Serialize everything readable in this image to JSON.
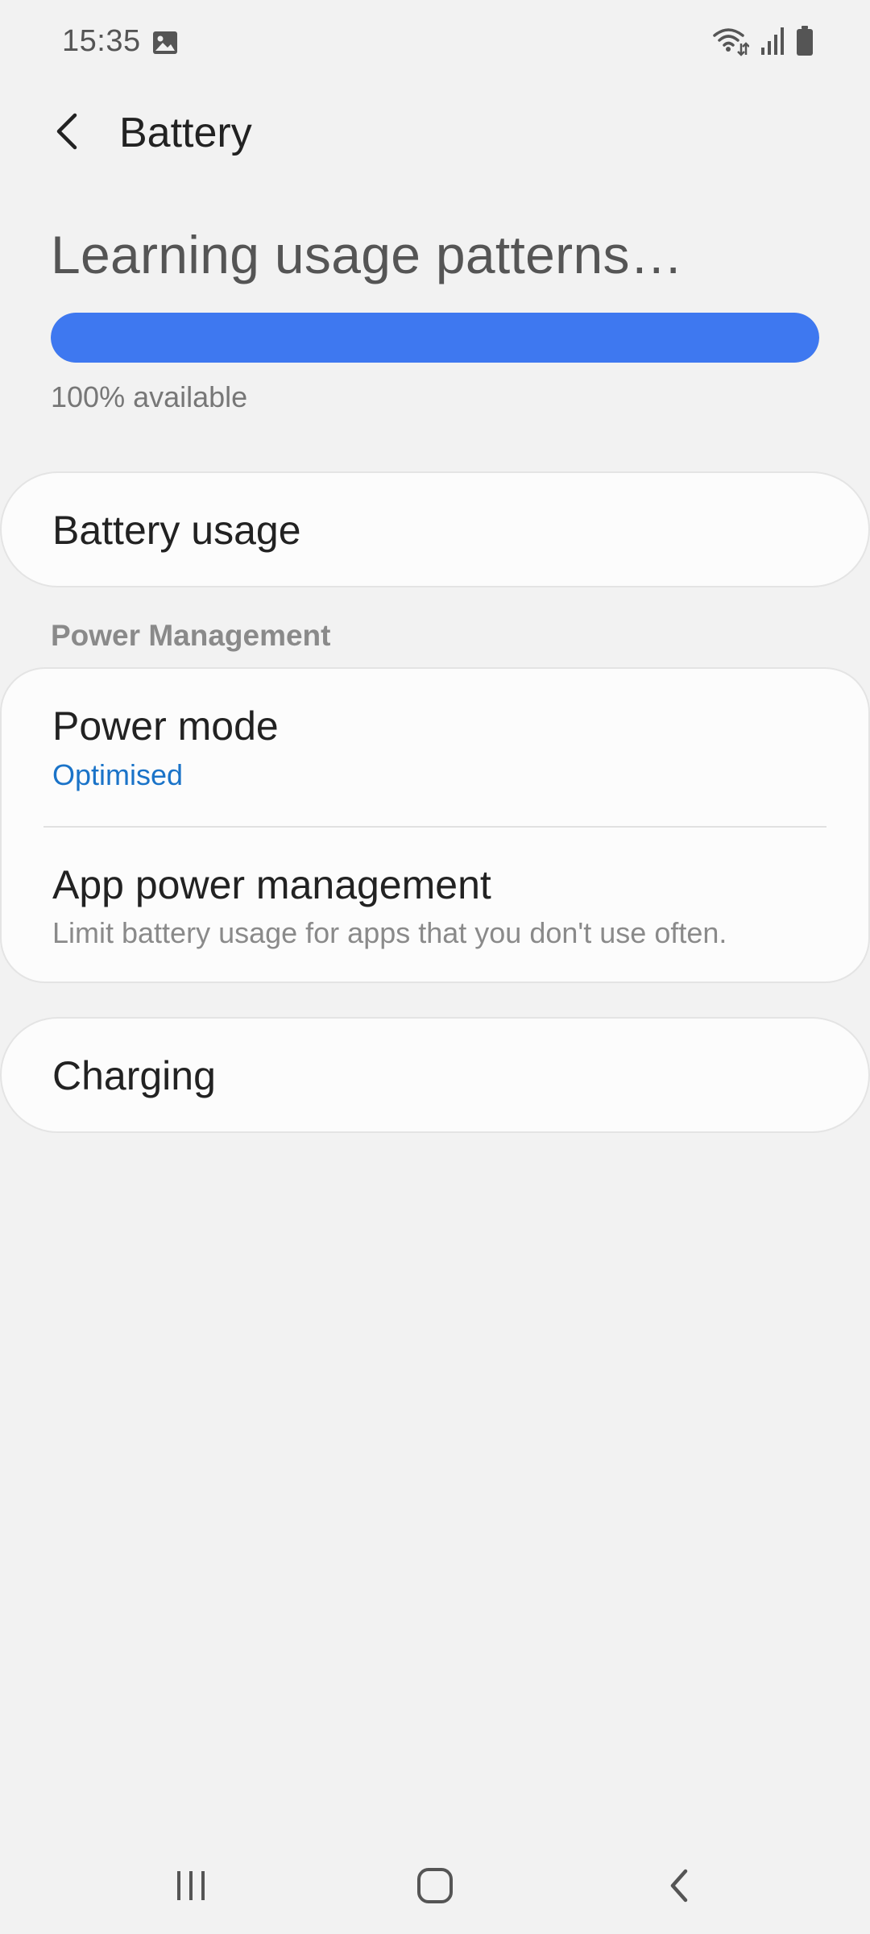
{
  "status_bar": {
    "time": "15:35",
    "icons": [
      "gallery-icon",
      "wifi-icon",
      "signal-icon",
      "battery-icon"
    ]
  },
  "app_bar": {
    "title": "Battery",
    "back_icon": "chevron-left-icon"
  },
  "battery_status": {
    "headline": "Learning usage patterns…",
    "available_text": "100% available",
    "level_fraction": 1.0,
    "bar_color": "#3e78f0"
  },
  "battery_usage": {
    "label": "Battery usage"
  },
  "power_management": {
    "section_title": "Power Management",
    "power_mode": {
      "label": "Power mode",
      "value": "Optimised",
      "value_color": "#1a73c8"
    },
    "app_power_management": {
      "label": "App power management",
      "description": "Limit battery usage for apps that you don't use often."
    }
  },
  "charging": {
    "label": "Charging"
  },
  "nav_bar": {
    "icons": [
      "recents-icon",
      "home-icon",
      "back-icon"
    ]
  }
}
